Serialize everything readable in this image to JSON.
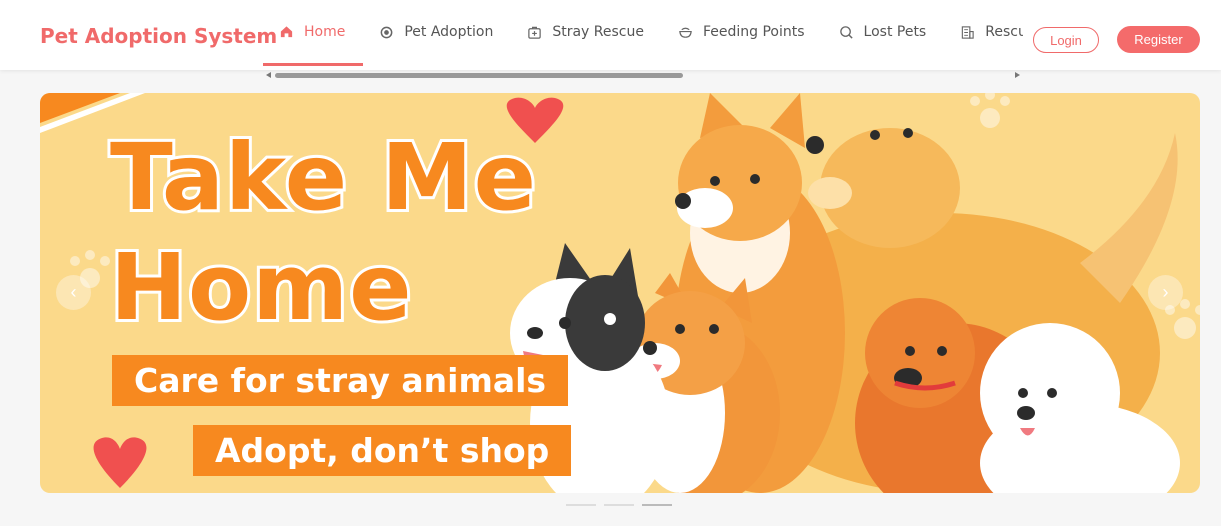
{
  "brand": {
    "title": "Pet Adoption System",
    "color": "#f06a6a"
  },
  "nav": {
    "items": [
      {
        "label": "Home",
        "icon": "home-icon",
        "active": true
      },
      {
        "label": "Pet Adoption",
        "icon": "paw-icon",
        "active": false
      },
      {
        "label": "Stray Rescue",
        "icon": "first-aid-kit-icon",
        "active": false
      },
      {
        "label": "Feeding Points",
        "icon": "food-bowl-icon",
        "active": false
      },
      {
        "label": "Lost Pets",
        "icon": "search-icon",
        "active": false
      },
      {
        "label": "Rescue Stations",
        "icon": "building-icon",
        "active": false
      }
    ]
  },
  "auth": {
    "login_label": "Login",
    "register_label": "Register"
  },
  "banner": {
    "headline": "Take Me Home",
    "tagline1": "Care for stray animals",
    "tagline2": "Adopt, don’t shop",
    "background": "#fbd98a",
    "accent": "#f7891f"
  },
  "carousel": {
    "prev_label": "‹",
    "next_label": "›",
    "slide_count": 3,
    "active_slide": 3
  }
}
